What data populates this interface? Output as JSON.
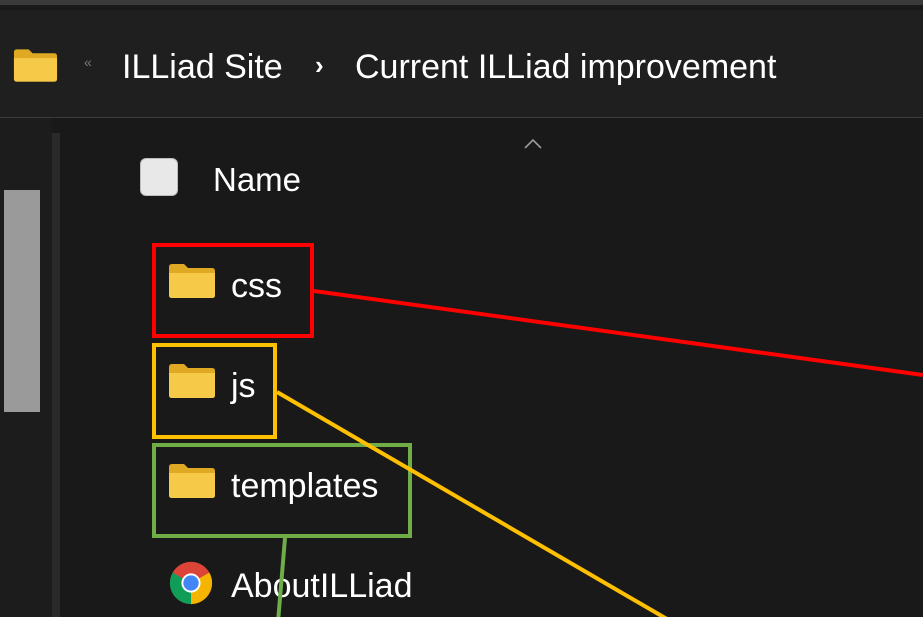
{
  "breadcrumb": {
    "overflow_glyph": "«",
    "items": [
      "ILLiad Site",
      "Current ILLiad improvement"
    ],
    "separator": "›"
  },
  "list_header": {
    "name_label": "Name",
    "sort_indicator": "chevron-up-icon"
  },
  "files": [
    {
      "name": "css",
      "icon": "folder-icon",
      "annotation_color": "#ff0000"
    },
    {
      "name": "js",
      "icon": "folder-icon",
      "annotation_color": "#ffc000"
    },
    {
      "name": "templates",
      "icon": "folder-icon",
      "annotation_color": "#70ad47"
    },
    {
      "name": "AboutILLiad",
      "icon": "chrome-icon",
      "annotation_color": ""
    }
  ],
  "colors": {
    "background": "#191919",
    "folder_yellow": "#f5c542",
    "annotation_red": "#ff0000",
    "annotation_yellow": "#ffc000",
    "annotation_green": "#70ad47"
  }
}
